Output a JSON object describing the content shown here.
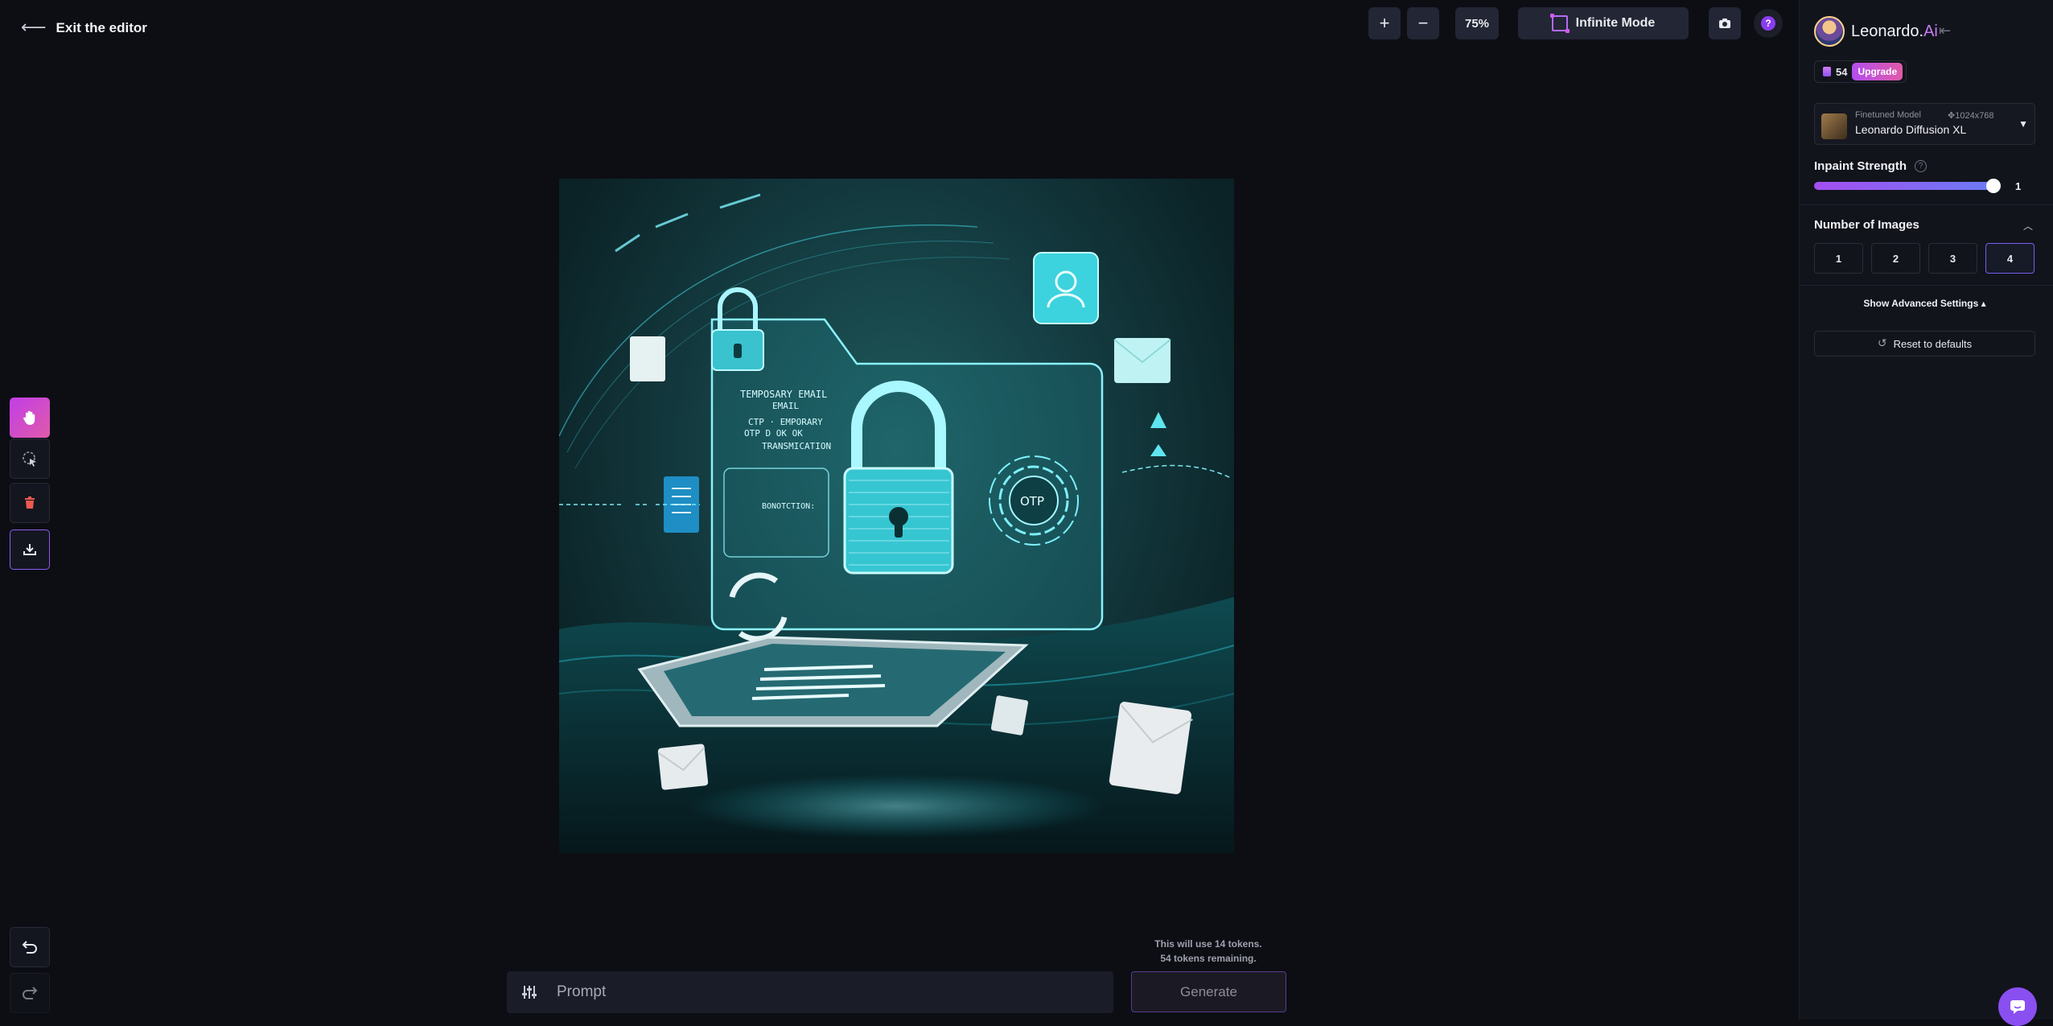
{
  "editor": {
    "exit_label": "Exit the editor"
  },
  "toolbar": {
    "zoom_in": "+",
    "zoom_out": "−",
    "zoom_level": "75%",
    "infinite_mode": "Infinite Mode",
    "help": "?"
  },
  "image_text": {
    "folder_line1": "TEMPOSARY EMAIL",
    "folder_line2": "EMAIL",
    "folder_line3": "CTP · EMPORARY",
    "folder_line4": "OTP   D  OK OK",
    "folder_line5": "TRANSMICATION",
    "folder_line6": "BONOTCTION:",
    "otp": "OTP"
  },
  "prompt": {
    "placeholder": "Prompt",
    "tokens_line1": "This will use 14 tokens.",
    "tokens_line2": "54 tokens remaining.",
    "generate_label": "Generate"
  },
  "sidebar": {
    "brand_name": "Leonardo.",
    "brand_ai": "Ai",
    "token_count": "54",
    "upgrade_label": "Upgrade",
    "model": {
      "kind": "Finetuned Model",
      "dims": "1024x768",
      "name": "Leonardo Diffusion XL"
    },
    "inpaint_title": "Inpaint Strength",
    "inpaint_value": "1",
    "inpaint_fraction": 1.0,
    "num_images_title": "Number of Images",
    "num_images_options": [
      "1",
      "2",
      "3",
      "4"
    ],
    "num_images_selected": "4",
    "advanced_label": "Show Advanced Settings",
    "reset_label": "Reset to defaults"
  },
  "colors": {
    "accent_purple": "#8a4ff0",
    "accent_pink": "#e05aa8",
    "background": "#0c0e14",
    "sidebar": "#12141c"
  }
}
